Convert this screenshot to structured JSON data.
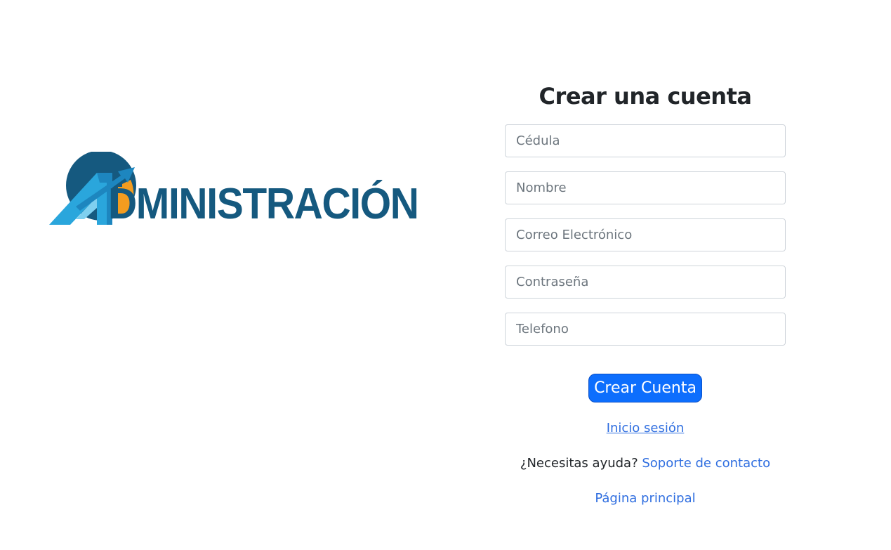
{
  "logo": {
    "text": "DMINISTRACIÓN",
    "colors": {
      "dark_blue": "#15597f",
      "light_blue": "#2aa6dc",
      "orange": "#f39c1f"
    }
  },
  "form": {
    "title": "Crear una cuenta",
    "fields": {
      "cedula": {
        "placeholder": "Cédula",
        "value": ""
      },
      "nombre": {
        "placeholder": "Nombre",
        "value": ""
      },
      "correo": {
        "placeholder": "Correo Electrónico",
        "value": ""
      },
      "contrasena": {
        "placeholder": "Contraseña",
        "value": ""
      },
      "telefono": {
        "placeholder": "Telefono",
        "value": ""
      }
    },
    "submit_label": "Crear Cuenta",
    "login_link": "Inicio sesión",
    "help_text": "¿Necesitas ayuda?",
    "support_link": "Soporte de contacto",
    "home_link": "Página principal"
  },
  "colors": {
    "primary": "#0d6efd",
    "link": "#2f6ee0",
    "text": "#212529",
    "border": "#ced4da"
  }
}
